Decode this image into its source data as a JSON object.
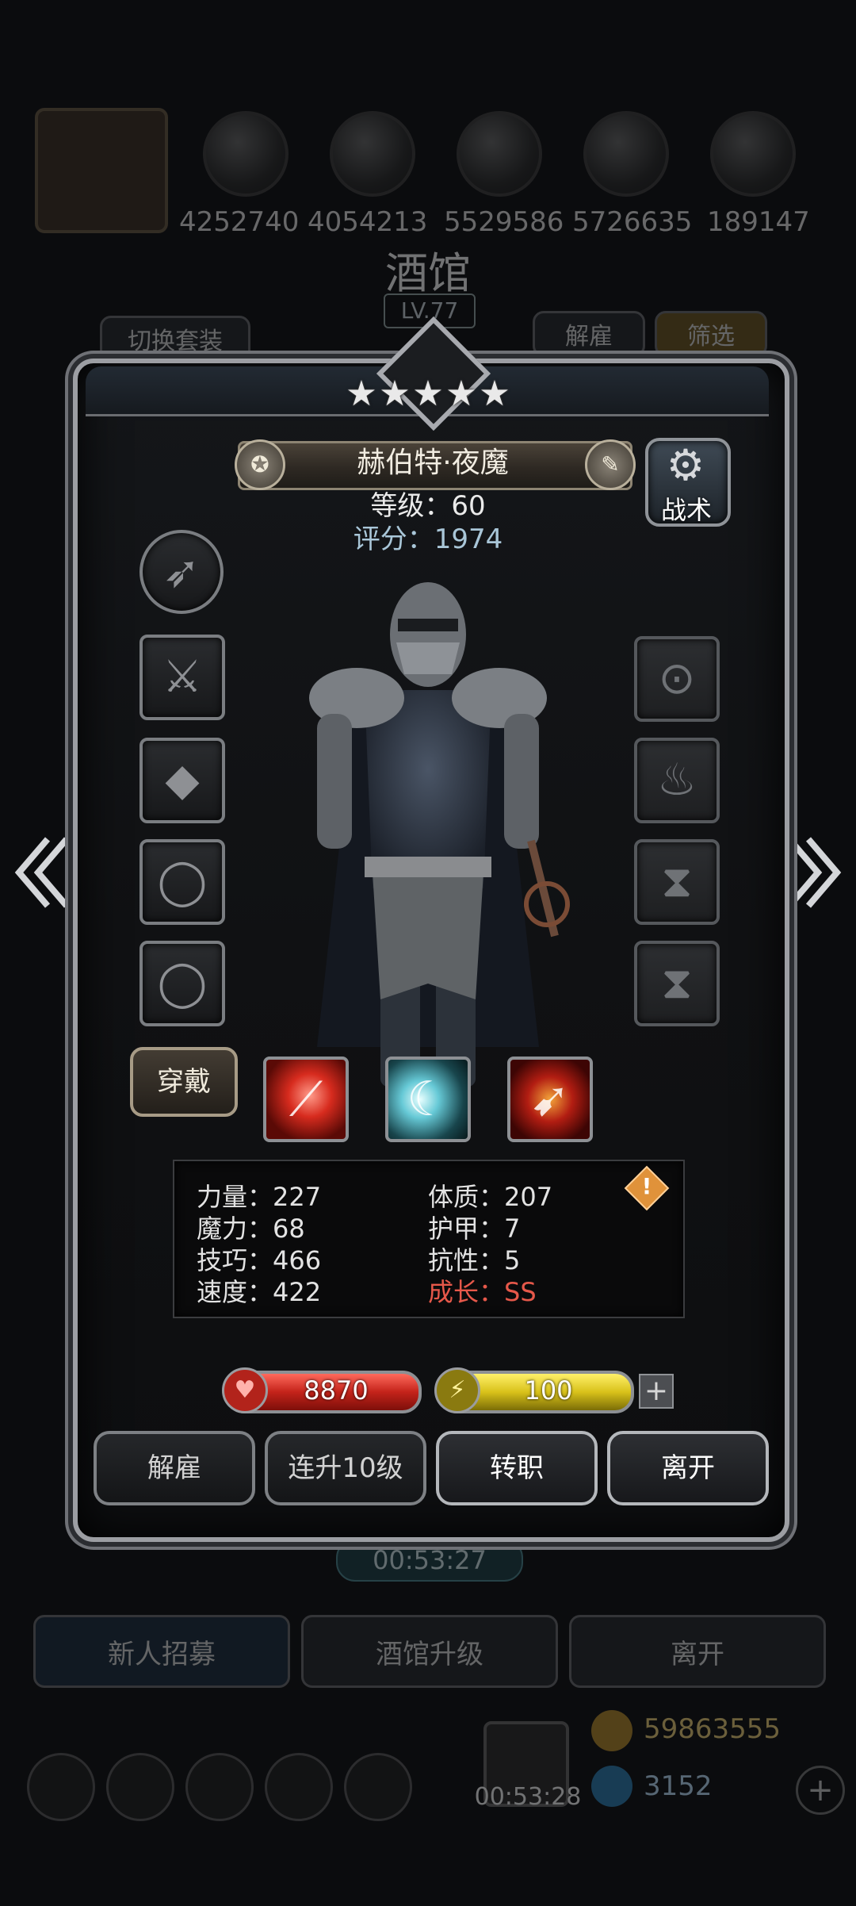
{
  "background": {
    "resources": [
      "4252740",
      "4054213",
      "5529586",
      "5726635",
      "189147"
    ],
    "hall_title": "酒馆",
    "hall_level": "LV.77",
    "switch_outfit": "切换套装",
    "dismiss_tab": "解雇",
    "filter_tab": "筛选",
    "timer_top": "00:53:27",
    "timer_bottom": "00:53:28",
    "bottom_buttons": [
      "新人招募",
      "酒馆升级",
      "离开"
    ],
    "gold": "59863555",
    "gems": "3152"
  },
  "hero": {
    "stars": 5,
    "name": "赫伯特·夜魔",
    "level_line": "等级：60",
    "score_line": "评分：1974",
    "tactic_label": "战术",
    "wear_button": "穿戴"
  },
  "stats": {
    "strength": "力量：227",
    "constitution": "体质：207",
    "magic": "魔力：68",
    "armor": "护甲：7",
    "skill": "技巧：466",
    "resistance": "抗性：5",
    "speed": "速度：422",
    "growth": "成长：SS"
  },
  "bars": {
    "hp": "8870",
    "energy": "100"
  },
  "actions": {
    "dismiss": "解雇",
    "level_up_10": "连升10级",
    "change_class": "转职",
    "leave": "离开"
  },
  "colors": {
    "growth": "#e6584a",
    "score": "#a9c6d8",
    "hp_bar": "#c4231a",
    "energy_bar": "#d9c21a"
  },
  "icons": [
    "gear-icon",
    "feather-icon",
    "blade-icon",
    "armor-icon",
    "ring-icon",
    "amulet-icon",
    "flame-icon",
    "hourglass-icon",
    "heart-icon",
    "lightning-icon",
    "warning-icon",
    "chevron-left-icon",
    "chevron-right-icon"
  ]
}
